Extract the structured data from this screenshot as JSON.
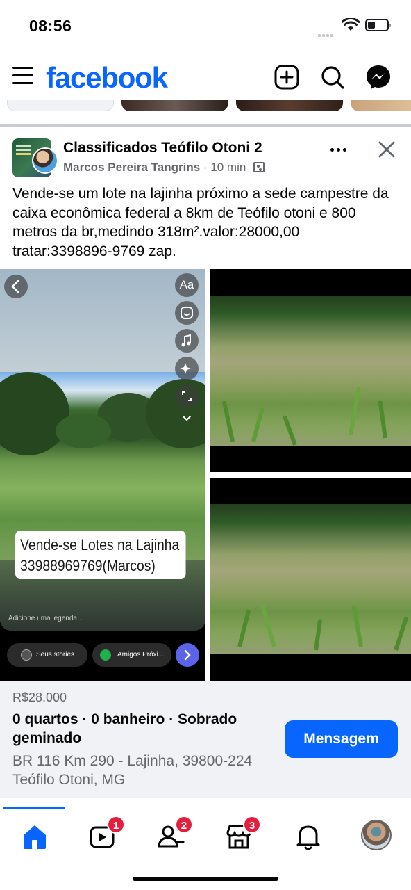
{
  "status_bar": {
    "time": "08:56"
  },
  "header": {
    "logo": "facebook",
    "icons": [
      "menu-icon",
      "add-icon",
      "search-icon",
      "messenger-icon"
    ],
    "brand_color": "#0866ff"
  },
  "post": {
    "group_name": "Classificados Teófilo Otoni 2",
    "author": "Marcos Pereira Tangrins",
    "separator": "·",
    "time": "10 min",
    "text": "Vende-se um lote na lajinha próximo a sede campestre da caixa econômica federal a 8km de Teófilo otoni e 800 metros da br,medindo 318m².valor:28000,00 tratar:3398896-9769 zap.",
    "media": {
      "story_caption_line1": "Vende-se Lotes na Lajinha",
      "story_caption_line2": "33988969769(Marcos)",
      "story_caption_hint": "Adicione uma legenda...",
      "story_tool_text": "Aa",
      "pill_my_stories": "Seus stories",
      "pill_close_friends": "Amigos Próxi..."
    }
  },
  "listing": {
    "price": "R$28.000",
    "specs": "0 quartos · 0 banheiro · Sobrado geminado",
    "address": "BR 116 Km 290 - Lajinha, 39800-224 Teófilo Otoni, MG",
    "message_button": "Mensagem"
  },
  "bottom_nav": {
    "badges": {
      "video": "1",
      "friends": "2",
      "marketplace": "3"
    }
  }
}
